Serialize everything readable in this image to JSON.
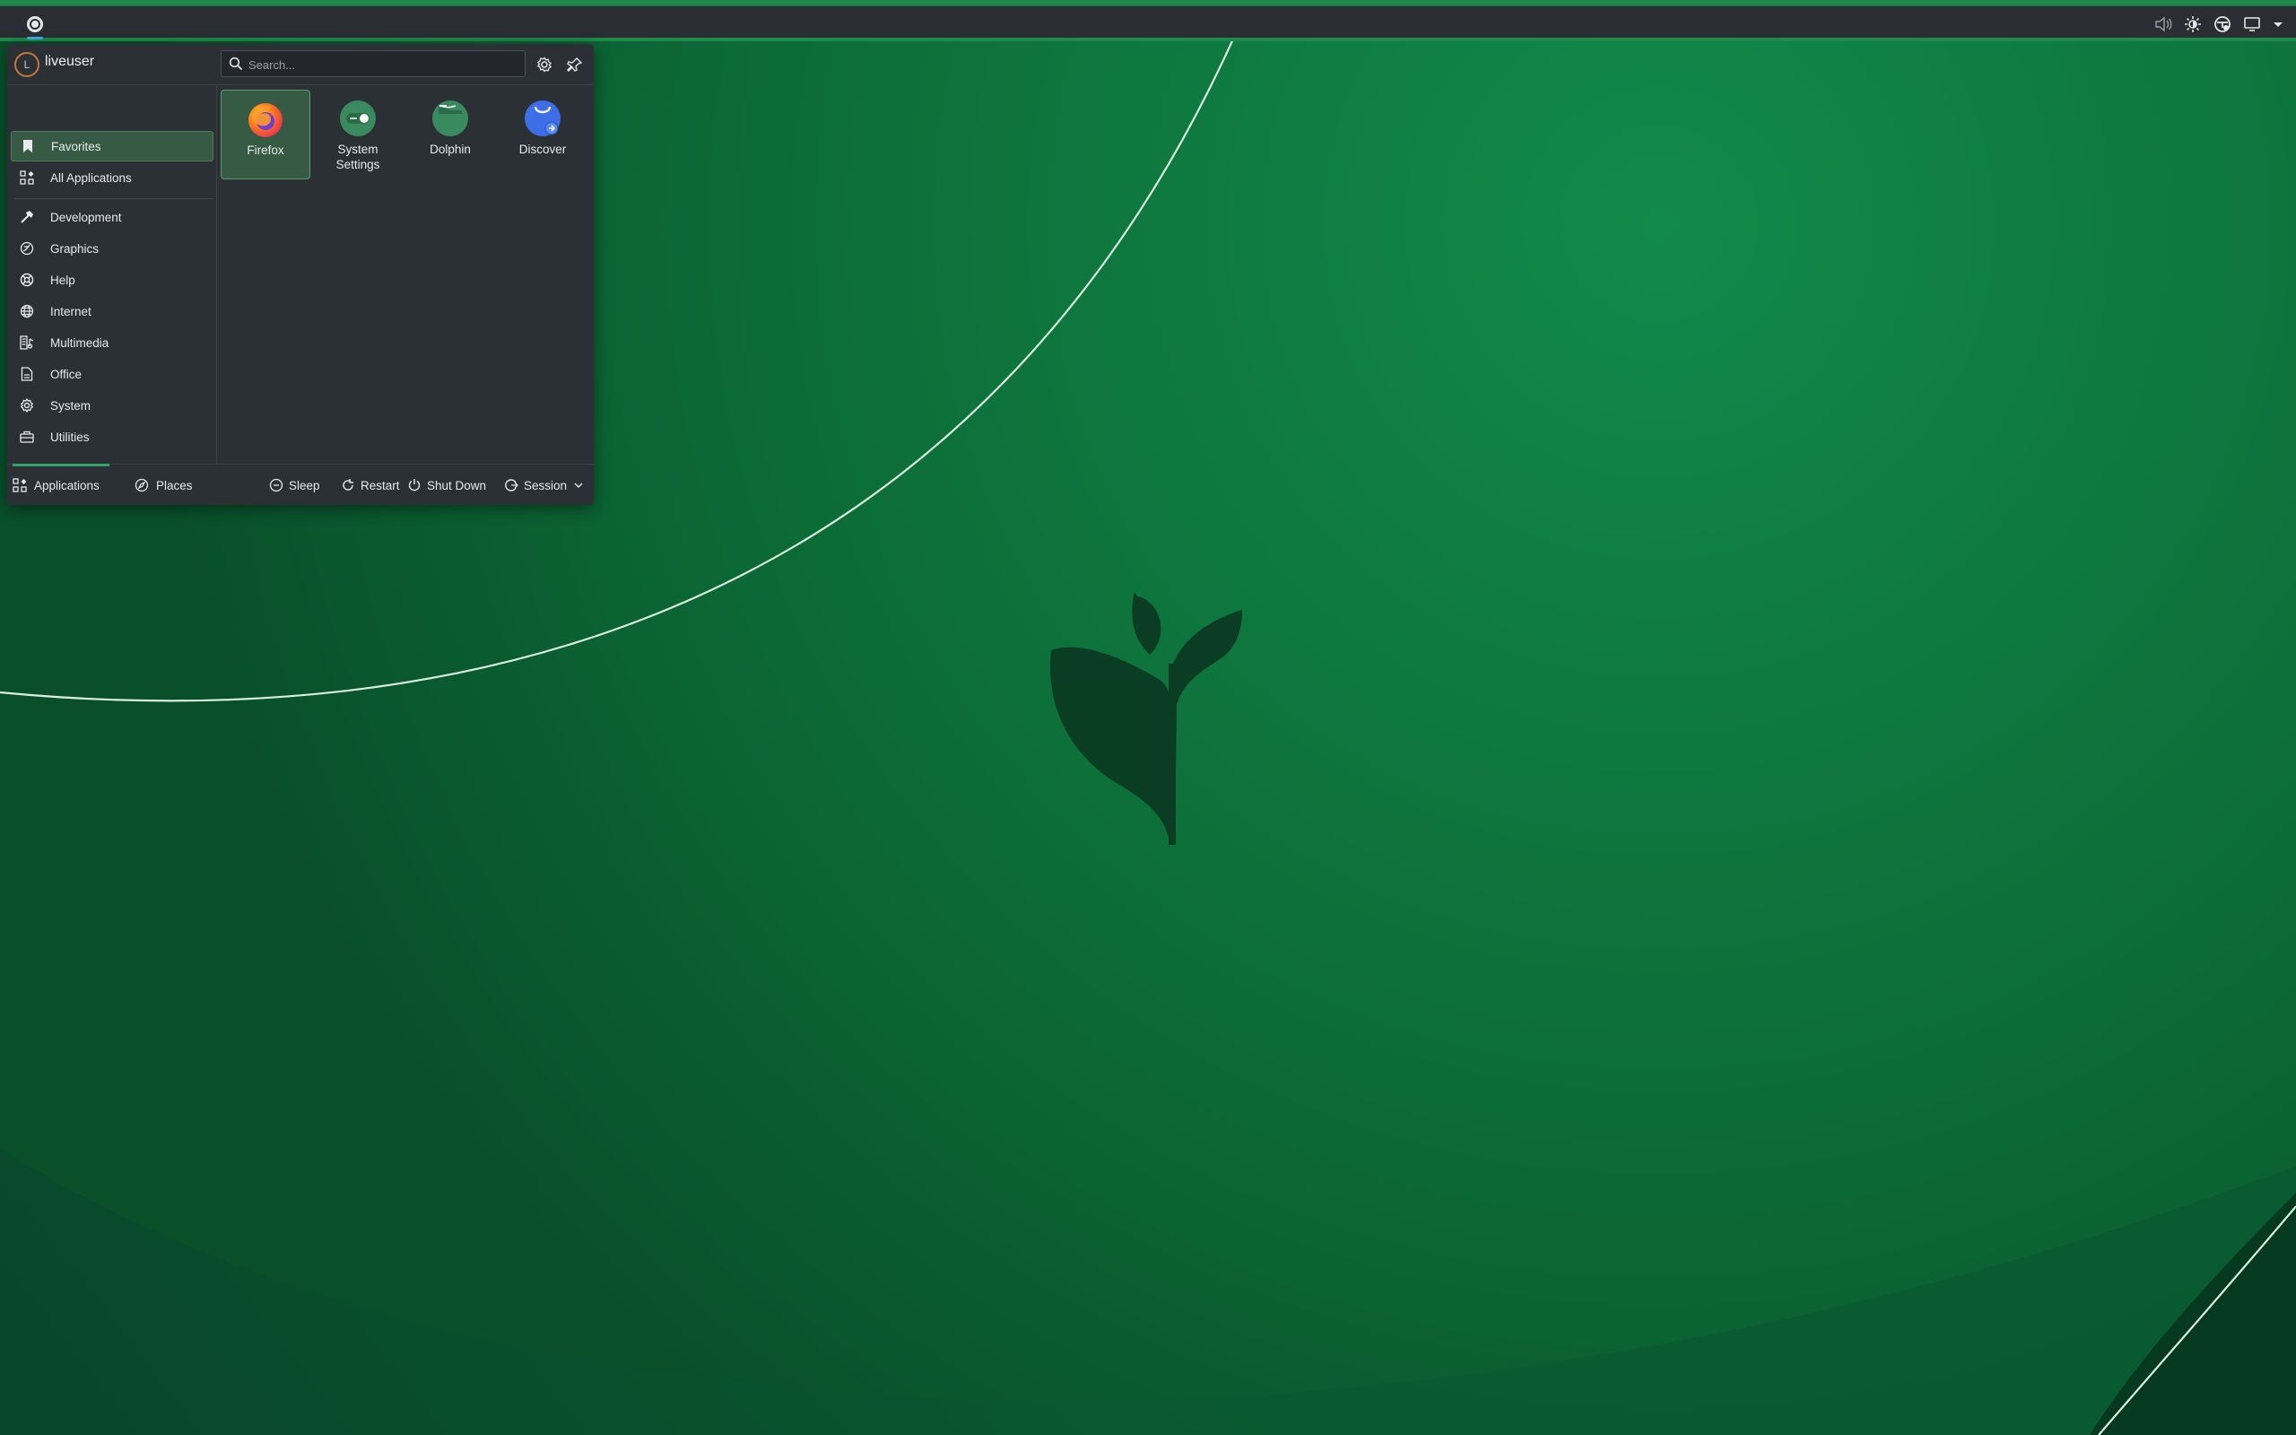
{
  "user": {
    "name": "liveuser",
    "avatar_initial": "L"
  },
  "search": {
    "placeholder": "Search..."
  },
  "categories": [
    {
      "label": "Favorites",
      "icon": "bookmark-icon",
      "selected": true
    },
    {
      "label": "All Applications",
      "icon": "grid-icon"
    },
    {
      "label": "Development",
      "icon": "hammer-icon"
    },
    {
      "label": "Graphics",
      "icon": "graphics-icon"
    },
    {
      "label": "Help",
      "icon": "lifebuoy-icon"
    },
    {
      "label": "Internet",
      "icon": "globe-icon"
    },
    {
      "label": "Multimedia",
      "icon": "multimedia-icon"
    },
    {
      "label": "Office",
      "icon": "document-icon"
    },
    {
      "label": "System",
      "icon": "gear-icon"
    },
    {
      "label": "Utilities",
      "icon": "toolbox-icon"
    }
  ],
  "favorites": [
    {
      "label": "Firefox",
      "icon": "firefox-icon",
      "selected": true
    },
    {
      "label": "System Settings",
      "icon": "settings-toggle-icon"
    },
    {
      "label": "Dolphin",
      "icon": "dolphin-folder-icon"
    },
    {
      "label": "Discover",
      "icon": "discover-bag-icon"
    }
  ],
  "footer": {
    "tabs": [
      {
        "label": "Applications",
        "icon": "grid-icon",
        "active": true
      },
      {
        "label": "Places",
        "icon": "compass-icon"
      }
    ],
    "power": [
      {
        "label": "Sleep",
        "icon": "sleep-icon"
      },
      {
        "label": "Restart",
        "icon": "restart-icon"
      },
      {
        "label": "Shut Down",
        "icon": "power-icon"
      },
      {
        "label": "Session",
        "icon": "session-icon"
      }
    ]
  },
  "tray": [
    "volume-muted-icon",
    "brightness-icon",
    "network-icon",
    "display-icon",
    "tray-expand-icon"
  ],
  "colors": {
    "accent": "#3daee9",
    "selection": "#365a44",
    "wallpaper": "#0a5c30"
  }
}
